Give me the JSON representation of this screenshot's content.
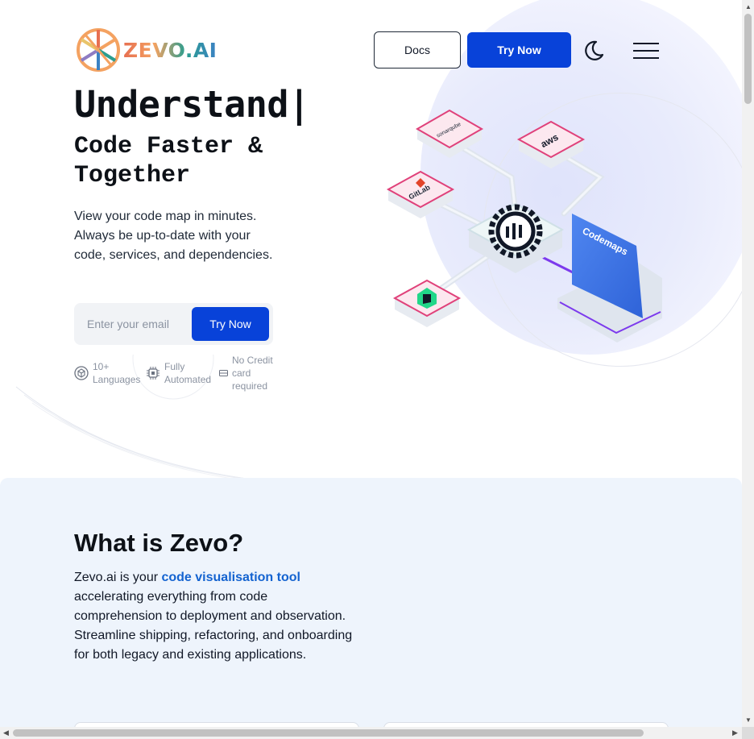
{
  "header": {
    "logo_text": "ZEVO.AI",
    "docs_label": "Docs",
    "try_now_label": "Try Now",
    "theme_icon": "moon-icon",
    "menu_icon": "hamburger-menu-icon"
  },
  "hero": {
    "headline": "Understand|",
    "subheadline": "Code Faster & Together",
    "description": "View your code map in minutes. Always be up-to-date with your code, services, and dependencies.",
    "email_placeholder": "Enter your email",
    "cta_label": "Try Now",
    "features": [
      {
        "icon": "cube-icon",
        "label": "10+ Languages"
      },
      {
        "icon": "chip-icon",
        "label": "Fully Automated"
      },
      {
        "icon": "card-icon",
        "label": "No Credit card required"
      }
    ]
  },
  "illustration": {
    "tiles": [
      "sonarqube",
      "aws",
      "GitLab",
      "Codemaps"
    ],
    "center_icon": "gear-icon"
  },
  "what_is": {
    "title": "What is Zevo?",
    "body_prefix": "Zevo.ai is your ",
    "body_highlight": "code visualisation tool",
    "body_suffix": " accelerating everything from code comprehension to deployment and observation. Streamline shipping, refactoring, and onboarding for both legacy and existing applications."
  },
  "colors": {
    "primary": "#0842d9",
    "highlight": "#1463d0",
    "section_bg": "#eef4fc",
    "tile_border": "#e0417a"
  }
}
